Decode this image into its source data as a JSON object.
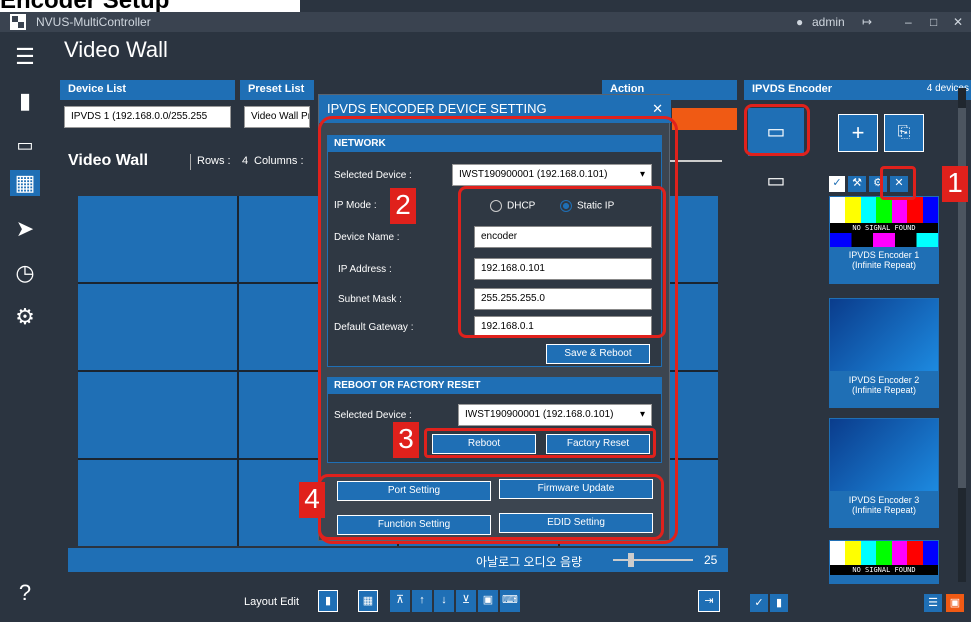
{
  "doc_title": "Encoder Setup",
  "app": {
    "title": "NVUS-MultiController",
    "user": "admin"
  },
  "header": {
    "title": "Video Wall"
  },
  "device_list": {
    "label": "Device List",
    "value": "IPVDS 1 (192.168.0.0/255.255"
  },
  "preset_list": {
    "label": "Preset List",
    "value": "Video Wall Pr"
  },
  "action": {
    "label": "Action"
  },
  "videowall": {
    "label": "Video Wall",
    "rows_label": "Rows :",
    "rows": "4",
    "cols_label": "Columns :"
  },
  "audio": {
    "label": "아날로그 오디오 음량",
    "value": "25"
  },
  "footer": {
    "layout_edit": "Layout Edit"
  },
  "modal": {
    "title": "IPVDS ENCODER DEVICE SETTING",
    "network": {
      "header": "NETWORK",
      "selected_device_label": "Selected Device :",
      "selected_device": "IWST190900001 (192.168.0.101)",
      "ip_mode_label": "IP Mode :",
      "dhcp": "DHCP",
      "static_ip": "Static IP",
      "device_name_label": "Device Name :",
      "device_name": "encoder",
      "ip_address_label": "IP Address :",
      "ip_address": "192.168.0.101",
      "subnet_label": "Subnet Mask :",
      "subnet": "255.255.255.0",
      "gateway_label": "Default Gateway :",
      "gateway": "192.168.0.1",
      "save_reboot": "Save & Reboot"
    },
    "reset": {
      "header": "REBOOT OR FACTORY RESET",
      "selected_device_label": "Selected Device :",
      "selected_device": "IWST190900001 (192.168.0.101)",
      "reboot": "Reboot",
      "factory_reset": "Factory Reset"
    },
    "buttons": {
      "port_setting": "Port Setting",
      "firmware_update": "Firmware Update",
      "function_setting": "Function Setting",
      "edid_setting": "EDID Setting"
    }
  },
  "right_panel": {
    "title": "IPVDS Encoder",
    "count": "4 devices",
    "encoders": [
      {
        "name": "IPVDS Encoder 1",
        "sub": "(Infinite Repeat)",
        "signal": "NO SIGNAL FOUND"
      },
      {
        "name": "IPVDS Encoder 2",
        "sub": "(Infinite Repeat)"
      },
      {
        "name": "IPVDS Encoder 3",
        "sub": "(Infinite Repeat)"
      },
      {
        "signal": "NO SIGNAL FOUND"
      }
    ]
  },
  "badges": [
    "1",
    "2",
    "3",
    "4"
  ],
  "colors": {
    "accent": "#1f6fb5",
    "highlight": "#e0211c",
    "orange": "#f05a14"
  }
}
